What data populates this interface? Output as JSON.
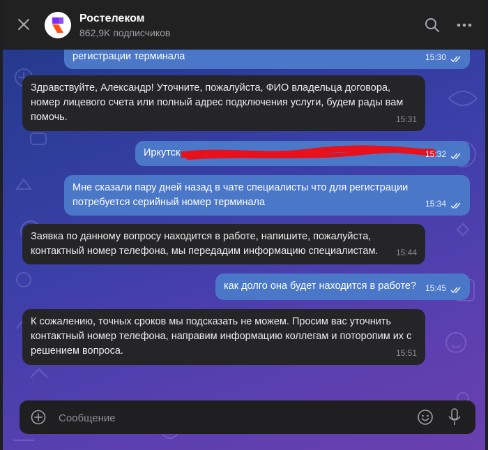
{
  "header": {
    "title": "Ростелеком",
    "subscribers": "862,9K подписчиков",
    "close_icon": "close-icon",
    "search_icon": "search-icon",
    "more_icon": "more-horizontal-icon",
    "brand_color": "#7b2ff2"
  },
  "messages": [
    {
      "direction": "out",
      "text": "регистрации терминала",
      "time": "15:30",
      "status": "read"
    },
    {
      "direction": "in",
      "text": "Здравствуйте, Александр! Уточните, пожалуйста, ФИО владельца договора, номер лицевого счета или полный адрес подключения услуги, будем рады вам помочь.",
      "time": "15:31"
    },
    {
      "direction": "out",
      "text": "Иркутск",
      "time": "15:32",
      "status": "read",
      "redacted": true
    },
    {
      "direction": "out",
      "text": "Мне сказали пару дней назад в чате специалисты что для регистрации потребуется серийный номер терминала",
      "time": "15:34",
      "status": "read"
    },
    {
      "direction": "in",
      "text": "Заявка по данному вопросу находится в работе, напишите, пожалуйста, контактный номер телефона, мы передадим информацию специалистам.",
      "time": "15:44"
    },
    {
      "direction": "out",
      "text": "как долго она будет находится в работе?",
      "time": "15:45",
      "status": "read"
    },
    {
      "direction": "in",
      "text": "К сожалению, точных сроков мы подсказать не можем. Просим вас уточнить контактный номер телефона, направим информацию коллегам и поторопим их с решением вопроса.",
      "time": "15:51"
    }
  ],
  "composer": {
    "placeholder": "Сообщение",
    "value": "",
    "attach_icon": "add-circle-icon",
    "emoji_icon": "emoji-icon",
    "mic_icon": "microphone-icon"
  },
  "colors": {
    "incoming_bubble": "#252527",
    "outgoing_bubble": "#4a77c8",
    "redaction": "#e8101a"
  }
}
